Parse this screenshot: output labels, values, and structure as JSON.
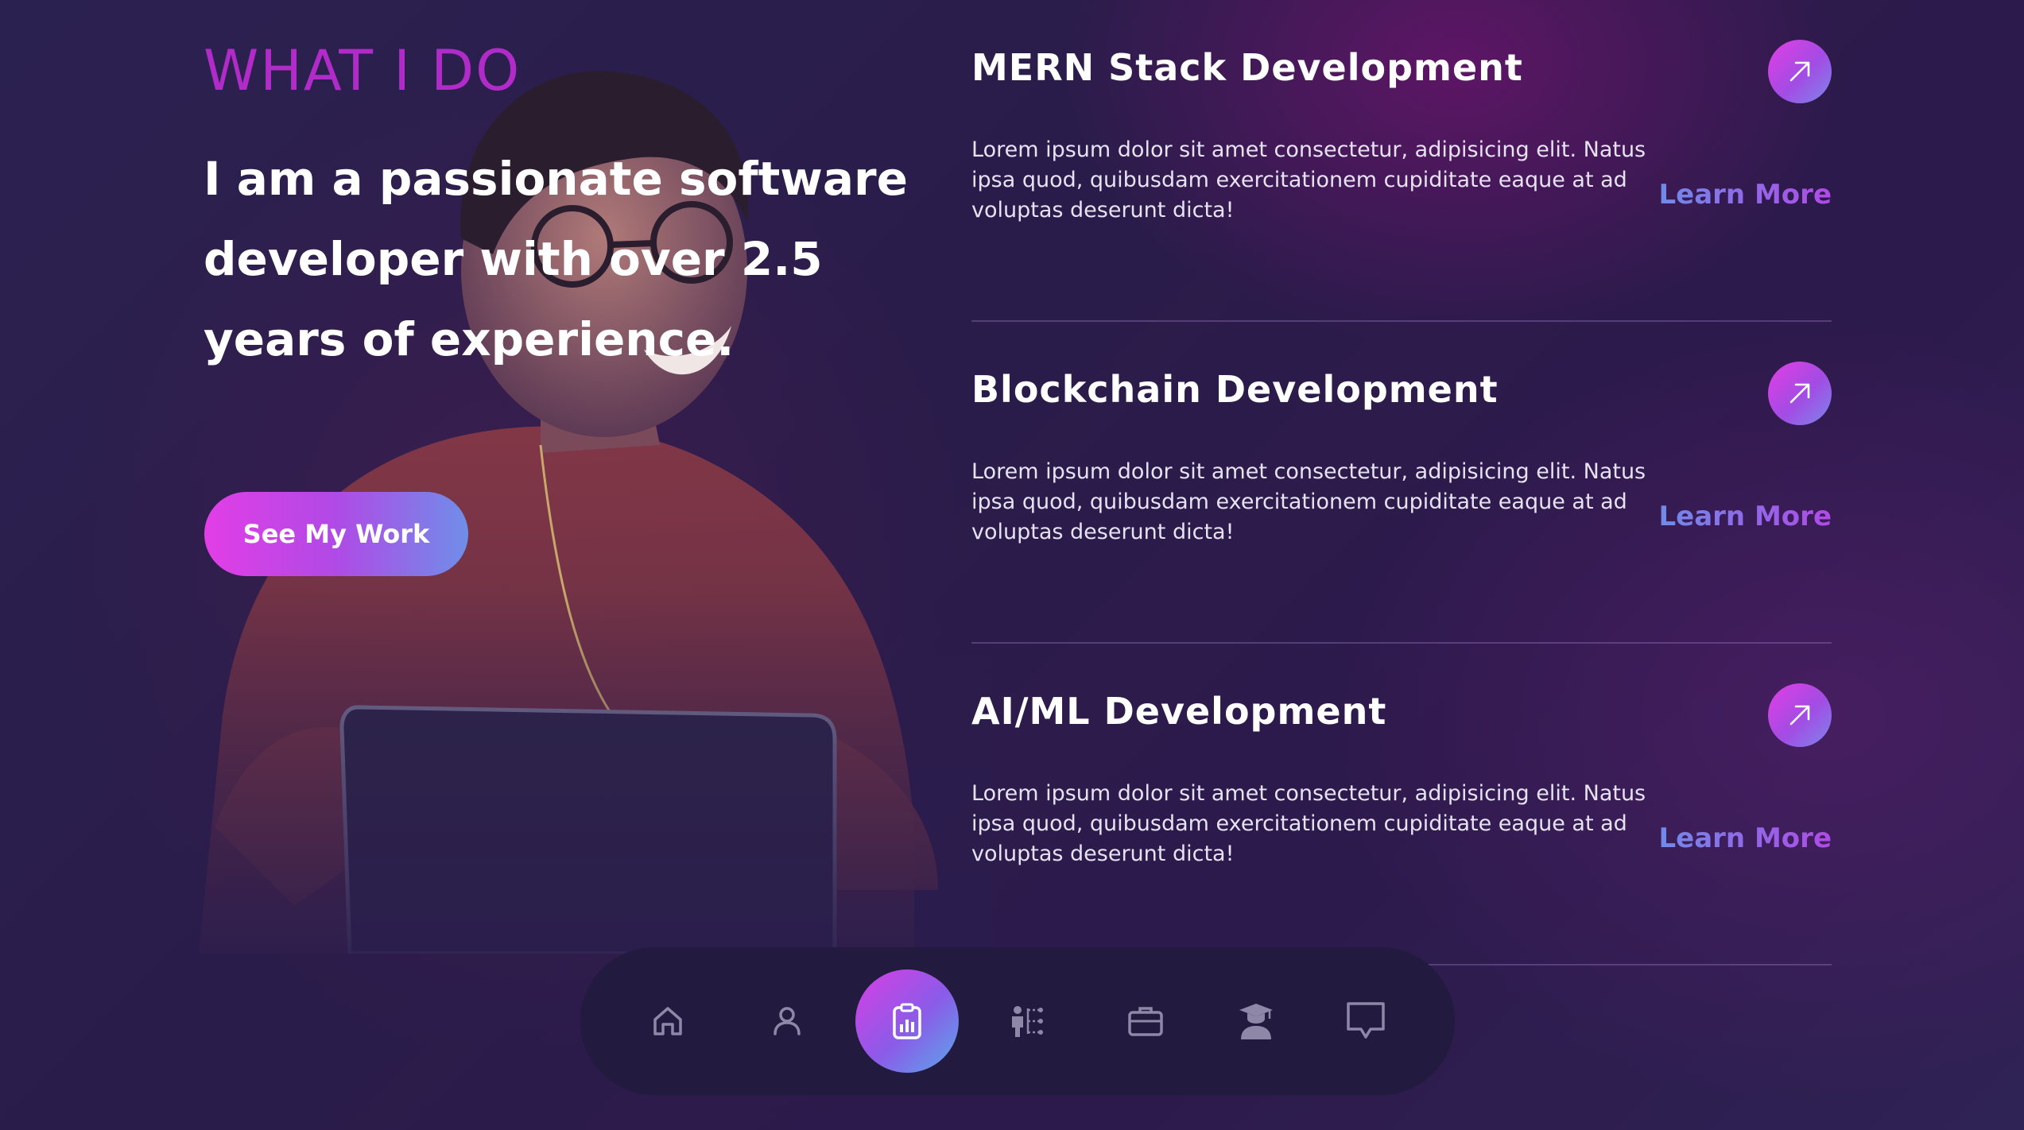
{
  "hero": {
    "kicker": "WHAT I DO",
    "lead": "I am a passionate software developer with over 2.5 years of experience.",
    "cta_label": "See My Work"
  },
  "services": [
    {
      "title": "MERN Stack Development",
      "description": "Lorem ipsum dolor sit amet consectetur, adipisicing elit. Natus ipsa quod, quibusdam exercitationem cupiditate eaque at ad voluptas deserunt dicta!",
      "link_label": "Learn More"
    },
    {
      "title": "Blockchain Development",
      "description": "Lorem ipsum dolor sit amet consectetur, adipisicing elit. Natus ipsa quod, quibusdam exercitationem cupiditate eaque at ad voluptas deserunt dicta!",
      "link_label": "Learn More"
    },
    {
      "title": "AI/ML Development",
      "description": "Lorem ipsum dolor sit amet consectetur, adipisicing elit. Natus ipsa quod, quibusdam exercitationem cupiditate eaque at ad voluptas deserunt dicta!",
      "link_label": "Learn More"
    }
  ],
  "dock": {
    "items": [
      {
        "icon": "home-icon",
        "active": false
      },
      {
        "icon": "user-icon",
        "active": false
      },
      {
        "icon": "clipboard-chart-icon",
        "active": true
      },
      {
        "icon": "skills-tree-icon",
        "active": false
      },
      {
        "icon": "briefcase-icon",
        "active": false
      },
      {
        "icon": "graduate-icon",
        "active": false
      },
      {
        "icon": "chat-icon",
        "active": false
      }
    ]
  },
  "colors": {
    "accent_magenta": "#b12bc8",
    "gradient_start": "#e23ee6",
    "gradient_end": "#6f8ee8",
    "background": "#2a1d4d",
    "dock_background": "#221a3f"
  }
}
